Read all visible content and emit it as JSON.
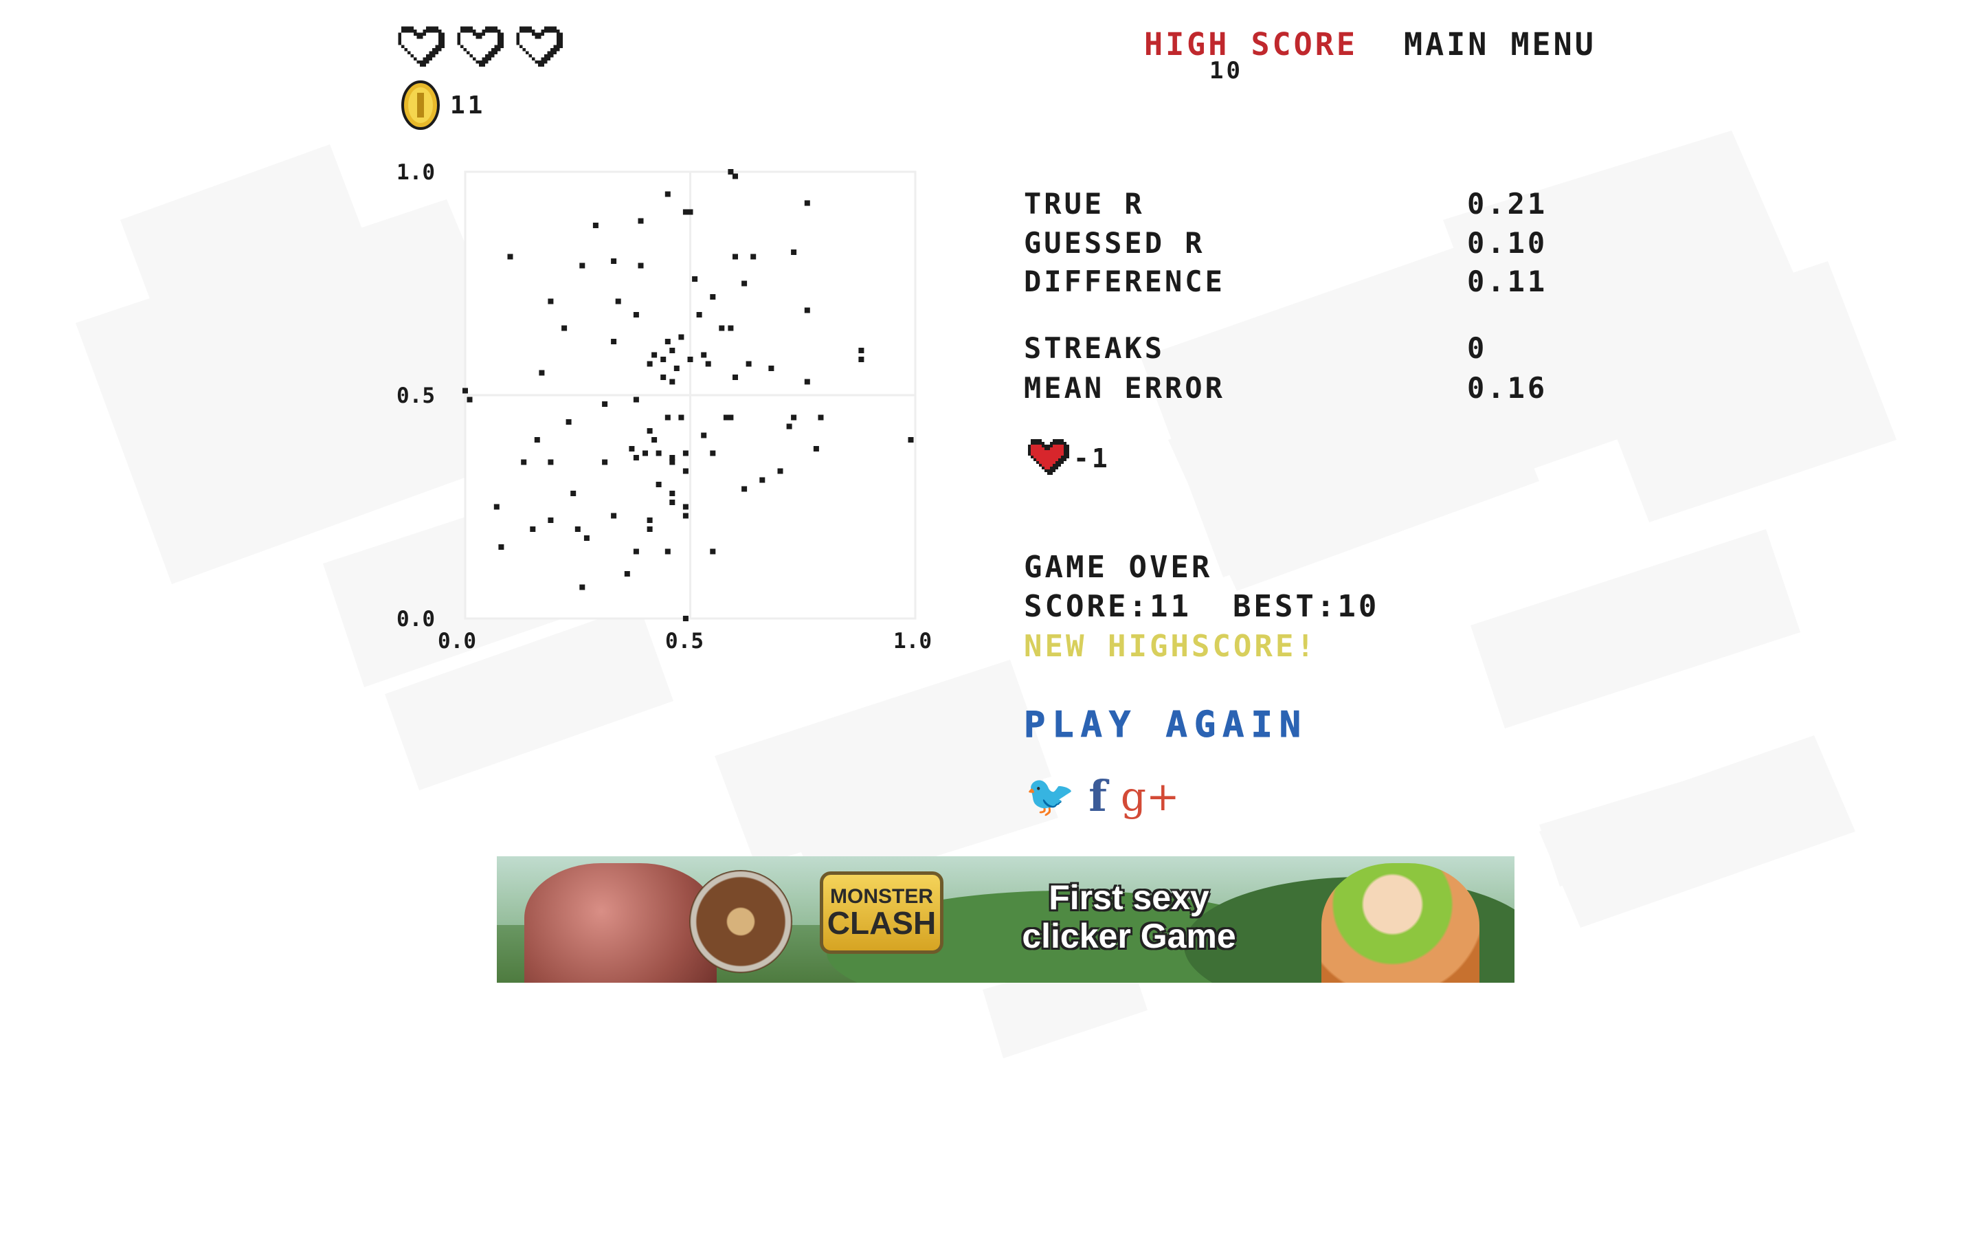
{
  "hud": {
    "lives_total": 3,
    "lives_remaining": 0,
    "coins": "11",
    "high_score_label": "HIGH SCORE",
    "high_score_value": "10",
    "main_menu_label": "MAIN MENU",
    "colors": {
      "high_score": "#c0282d",
      "heart_outline": "#1b1b1b"
    }
  },
  "stats": {
    "rows": [
      {
        "label": "TRUE R",
        "value": "0.21"
      },
      {
        "label": "GUESSED R",
        "value": "0.10"
      },
      {
        "label": "DIFFERENCE",
        "value": "0.11"
      },
      {
        "label": "STREAKS",
        "value": "0"
      },
      {
        "label": "MEAN ERROR",
        "value": "0.16"
      }
    ],
    "lives_change": "-1",
    "lives_change_icon": "heart-icon"
  },
  "result": {
    "game_over": "GAME OVER",
    "score_label": "SCORE:",
    "score_value": "11",
    "best_label": "BEST:",
    "best_value": "10",
    "new_highscore": "NEW HIGHSCORE!",
    "play_again": "PLAY AGAIN",
    "colors": {
      "new_highscore": "#d8cf5c",
      "play_again": "#2b63b3"
    }
  },
  "social": {
    "icons": [
      "twitter-icon",
      "facebook-icon",
      "google-plus-icon"
    ],
    "twitter_glyph": "🐦",
    "facebook_glyph": "f",
    "google_glyph": "g+"
  },
  "ad": {
    "logo_line1": "MONSTER",
    "logo_line2": "CLASH",
    "tagline": "First sexy clicker Game"
  },
  "chart_data": {
    "type": "scatter",
    "xlim": [
      0.0,
      1.0
    ],
    "ylim": [
      0.0,
      1.0
    ],
    "x_ticks": [
      "0.0",
      "0.5",
      "1.0"
    ],
    "y_ticks": [
      "0.0",
      "0.5",
      "1.0"
    ],
    "grid": "center lines at 0.5",
    "points": [
      [
        0.6,
        0.99
      ],
      [
        0.59,
        1.0
      ],
      [
        0.45,
        0.95
      ],
      [
        0.49,
        0.91
      ],
      [
        0.5,
        0.91
      ],
      [
        0.76,
        0.93
      ],
      [
        0.29,
        0.88
      ],
      [
        0.39,
        0.89
      ],
      [
        0.1,
        0.81
      ],
      [
        0.26,
        0.79
      ],
      [
        0.33,
        0.8
      ],
      [
        0.39,
        0.79
      ],
      [
        0.6,
        0.81
      ],
      [
        0.64,
        0.81
      ],
      [
        0.73,
        0.82
      ],
      [
        0.51,
        0.76
      ],
      [
        0.62,
        0.75
      ],
      [
        0.19,
        0.71
      ],
      [
        0.34,
        0.71
      ],
      [
        0.55,
        0.72
      ],
      [
        0.38,
        0.68
      ],
      [
        0.52,
        0.68
      ],
      [
        0.76,
        0.69
      ],
      [
        0.22,
        0.65
      ],
      [
        0.57,
        0.65
      ],
      [
        0.59,
        0.65
      ],
      [
        0.33,
        0.62
      ],
      [
        0.45,
        0.62
      ],
      [
        0.48,
        0.63
      ],
      [
        0.46,
        0.6
      ],
      [
        0.42,
        0.59
      ],
      [
        0.44,
        0.58
      ],
      [
        0.53,
        0.59
      ],
      [
        0.54,
        0.57
      ],
      [
        0.47,
        0.56
      ],
      [
        0.41,
        0.57
      ],
      [
        0.5,
        0.58
      ],
      [
        0.63,
        0.57
      ],
      [
        0.68,
        0.56
      ],
      [
        0.88,
        0.6
      ],
      [
        0.88,
        0.58
      ],
      [
        0.17,
        0.55
      ],
      [
        0.44,
        0.54
      ],
      [
        0.46,
        0.53
      ],
      [
        0.6,
        0.54
      ],
      [
        0.76,
        0.53
      ],
      [
        0.0,
        0.51
      ],
      [
        0.01,
        0.49
      ],
      [
        0.38,
        0.49
      ],
      [
        0.31,
        0.48
      ],
      [
        0.45,
        0.45
      ],
      [
        0.48,
        0.45
      ],
      [
        0.58,
        0.45
      ],
      [
        0.59,
        0.45
      ],
      [
        0.73,
        0.45
      ],
      [
        0.79,
        0.45
      ],
      [
        0.23,
        0.44
      ],
      [
        0.41,
        0.42
      ],
      [
        0.53,
        0.41
      ],
      [
        0.72,
        0.43
      ],
      [
        0.16,
        0.4
      ],
      [
        0.42,
        0.4
      ],
      [
        0.37,
        0.38
      ],
      [
        0.4,
        0.37
      ],
      [
        0.43,
        0.37
      ],
      [
        0.38,
        0.36
      ],
      [
        0.46,
        0.36
      ],
      [
        0.49,
        0.37
      ],
      [
        0.55,
        0.37
      ],
      [
        0.78,
        0.38
      ],
      [
        0.99,
        0.4
      ],
      [
        0.13,
        0.35
      ],
      [
        0.19,
        0.35
      ],
      [
        0.31,
        0.35
      ],
      [
        0.46,
        0.35
      ],
      [
        0.49,
        0.33
      ],
      [
        0.7,
        0.33
      ],
      [
        0.66,
        0.31
      ],
      [
        0.43,
        0.3
      ],
      [
        0.62,
        0.29
      ],
      [
        0.24,
        0.28
      ],
      [
        0.46,
        0.28
      ],
      [
        0.07,
        0.25
      ],
      [
        0.46,
        0.26
      ],
      [
        0.49,
        0.25
      ],
      [
        0.33,
        0.23
      ],
      [
        0.49,
        0.23
      ],
      [
        0.19,
        0.22
      ],
      [
        0.41,
        0.22
      ],
      [
        0.15,
        0.2
      ],
      [
        0.25,
        0.2
      ],
      [
        0.41,
        0.2
      ],
      [
        0.27,
        0.18
      ],
      [
        0.08,
        0.16
      ],
      [
        0.38,
        0.15
      ],
      [
        0.45,
        0.15
      ],
      [
        0.55,
        0.15
      ],
      [
        0.36,
        0.1
      ],
      [
        0.26,
        0.07
      ],
      [
        0.49,
        0.0
      ]
    ]
  }
}
